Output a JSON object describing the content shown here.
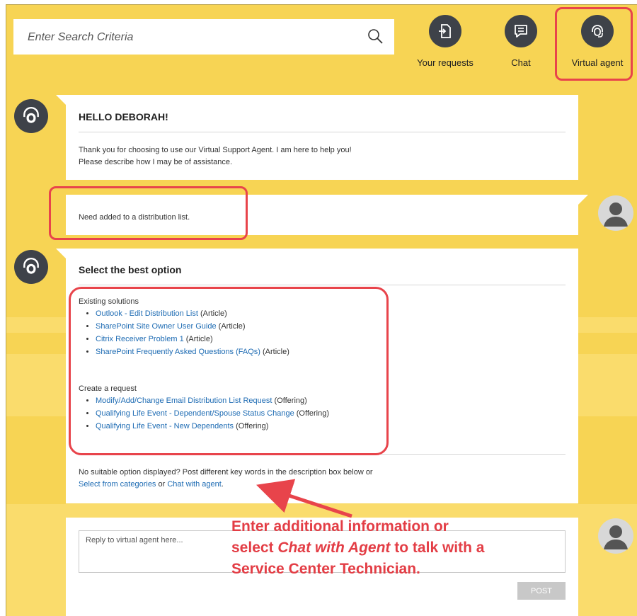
{
  "search": {
    "placeholder": "Enter Search Criteria"
  },
  "nav": {
    "your_requests": "Your requests",
    "chat": "Chat",
    "virtual_agent": "Virtual agent"
  },
  "greeting": {
    "title": "HELLO DEBORAH!",
    "line1": "Thank you for choosing to use our Virtual Support Agent. I am here to help you!",
    "line2": "Please describe how I may be of assistance."
  },
  "user_message": {
    "text": "Need added to a distribution list."
  },
  "options": {
    "title": "Select the best option",
    "existing_title": "Existing solutions",
    "existing": [
      {
        "link": "Outlook - Edit Distribution List",
        "type": "(Article)"
      },
      {
        "link": "SharePoint Site Owner User Guide",
        "type": "(Article)"
      },
      {
        "link": "Citrix Receiver Problem 1",
        "type": "(Article)"
      },
      {
        "link": "SharePoint Frequently Asked Questions (FAQs)",
        "type": "(Article)"
      }
    ],
    "request_title": "Create a request",
    "requests": [
      {
        "link": "Modify/Add/Change Email Distribution List Request",
        "type": "(Offering)"
      },
      {
        "link": "Qualifying Life Event - Dependent/Spouse Status Change",
        "type": "(Offering)"
      },
      {
        "link": "Qualifying Life Event - New Dependents",
        "type": "(Offering)"
      }
    ],
    "footer_text": "No suitable option displayed? Post different key words in the description box below or",
    "categories_link": "Select from categories",
    "or_text": "or",
    "chat_agent_link": "Chat with agent",
    "period": "."
  },
  "reply": {
    "placeholder": "Reply to virtual agent here...",
    "post_label": "POST"
  },
  "callout": {
    "line1": "Enter additional information or",
    "line2_prefix": "select",
    "line2_italic": "Chat with Agent",
    "line2_suffix": "to talk with a",
    "line3": "Service Center Technician."
  },
  "colors": {
    "background": "#f7d454",
    "highlight": "#e8444b",
    "link": "#1d6bb3",
    "avatar": "#3e4249"
  },
  "icons": {
    "search": "magnifier-icon",
    "your_requests": "document-icon",
    "chat": "chat-bubble-icon",
    "virtual_agent": "headset-icon"
  }
}
